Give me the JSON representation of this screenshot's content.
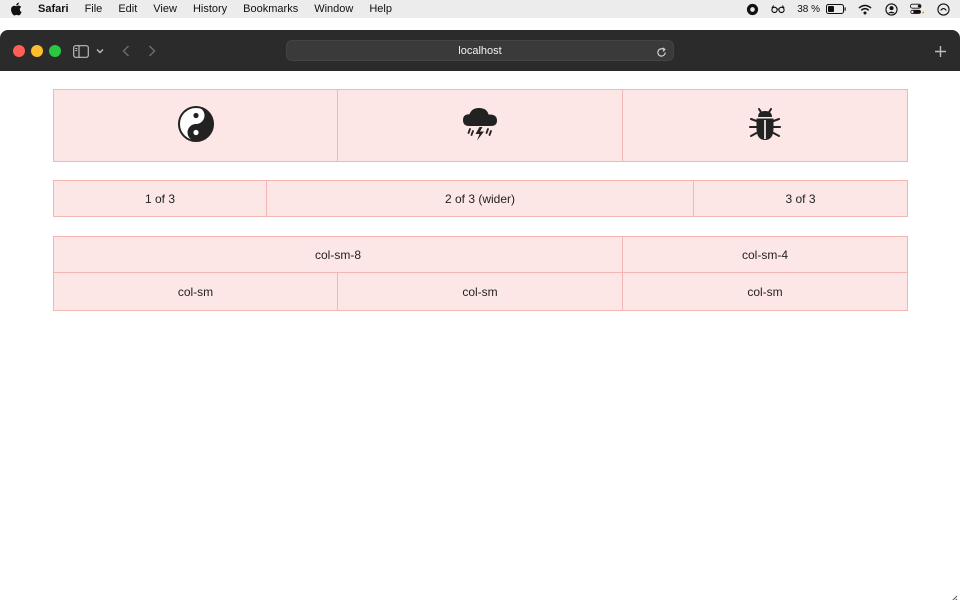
{
  "menubar": {
    "app_name": "Safari",
    "items": [
      "File",
      "Edit",
      "View",
      "History",
      "Bookmarks",
      "Window",
      "Help"
    ],
    "battery_percent": "38 %"
  },
  "browser": {
    "url": "localhost"
  },
  "page": {
    "icon_row": [
      "yin-yang-icon",
      "cloud-storm-icon",
      "bug-icon"
    ],
    "row2": [
      "1 of 3",
      "2 of 3 (wider)",
      "3 of 3"
    ],
    "row3": [
      "col-sm-8",
      "col-sm-4"
    ],
    "row4": [
      "col-sm",
      "col-sm",
      "col-sm"
    ]
  },
  "colors": {
    "cell_bg": "#fde6e6",
    "cell_border": "#f3b7b3",
    "toolbar": "#2b2b2b",
    "menubar": "#ececec"
  }
}
